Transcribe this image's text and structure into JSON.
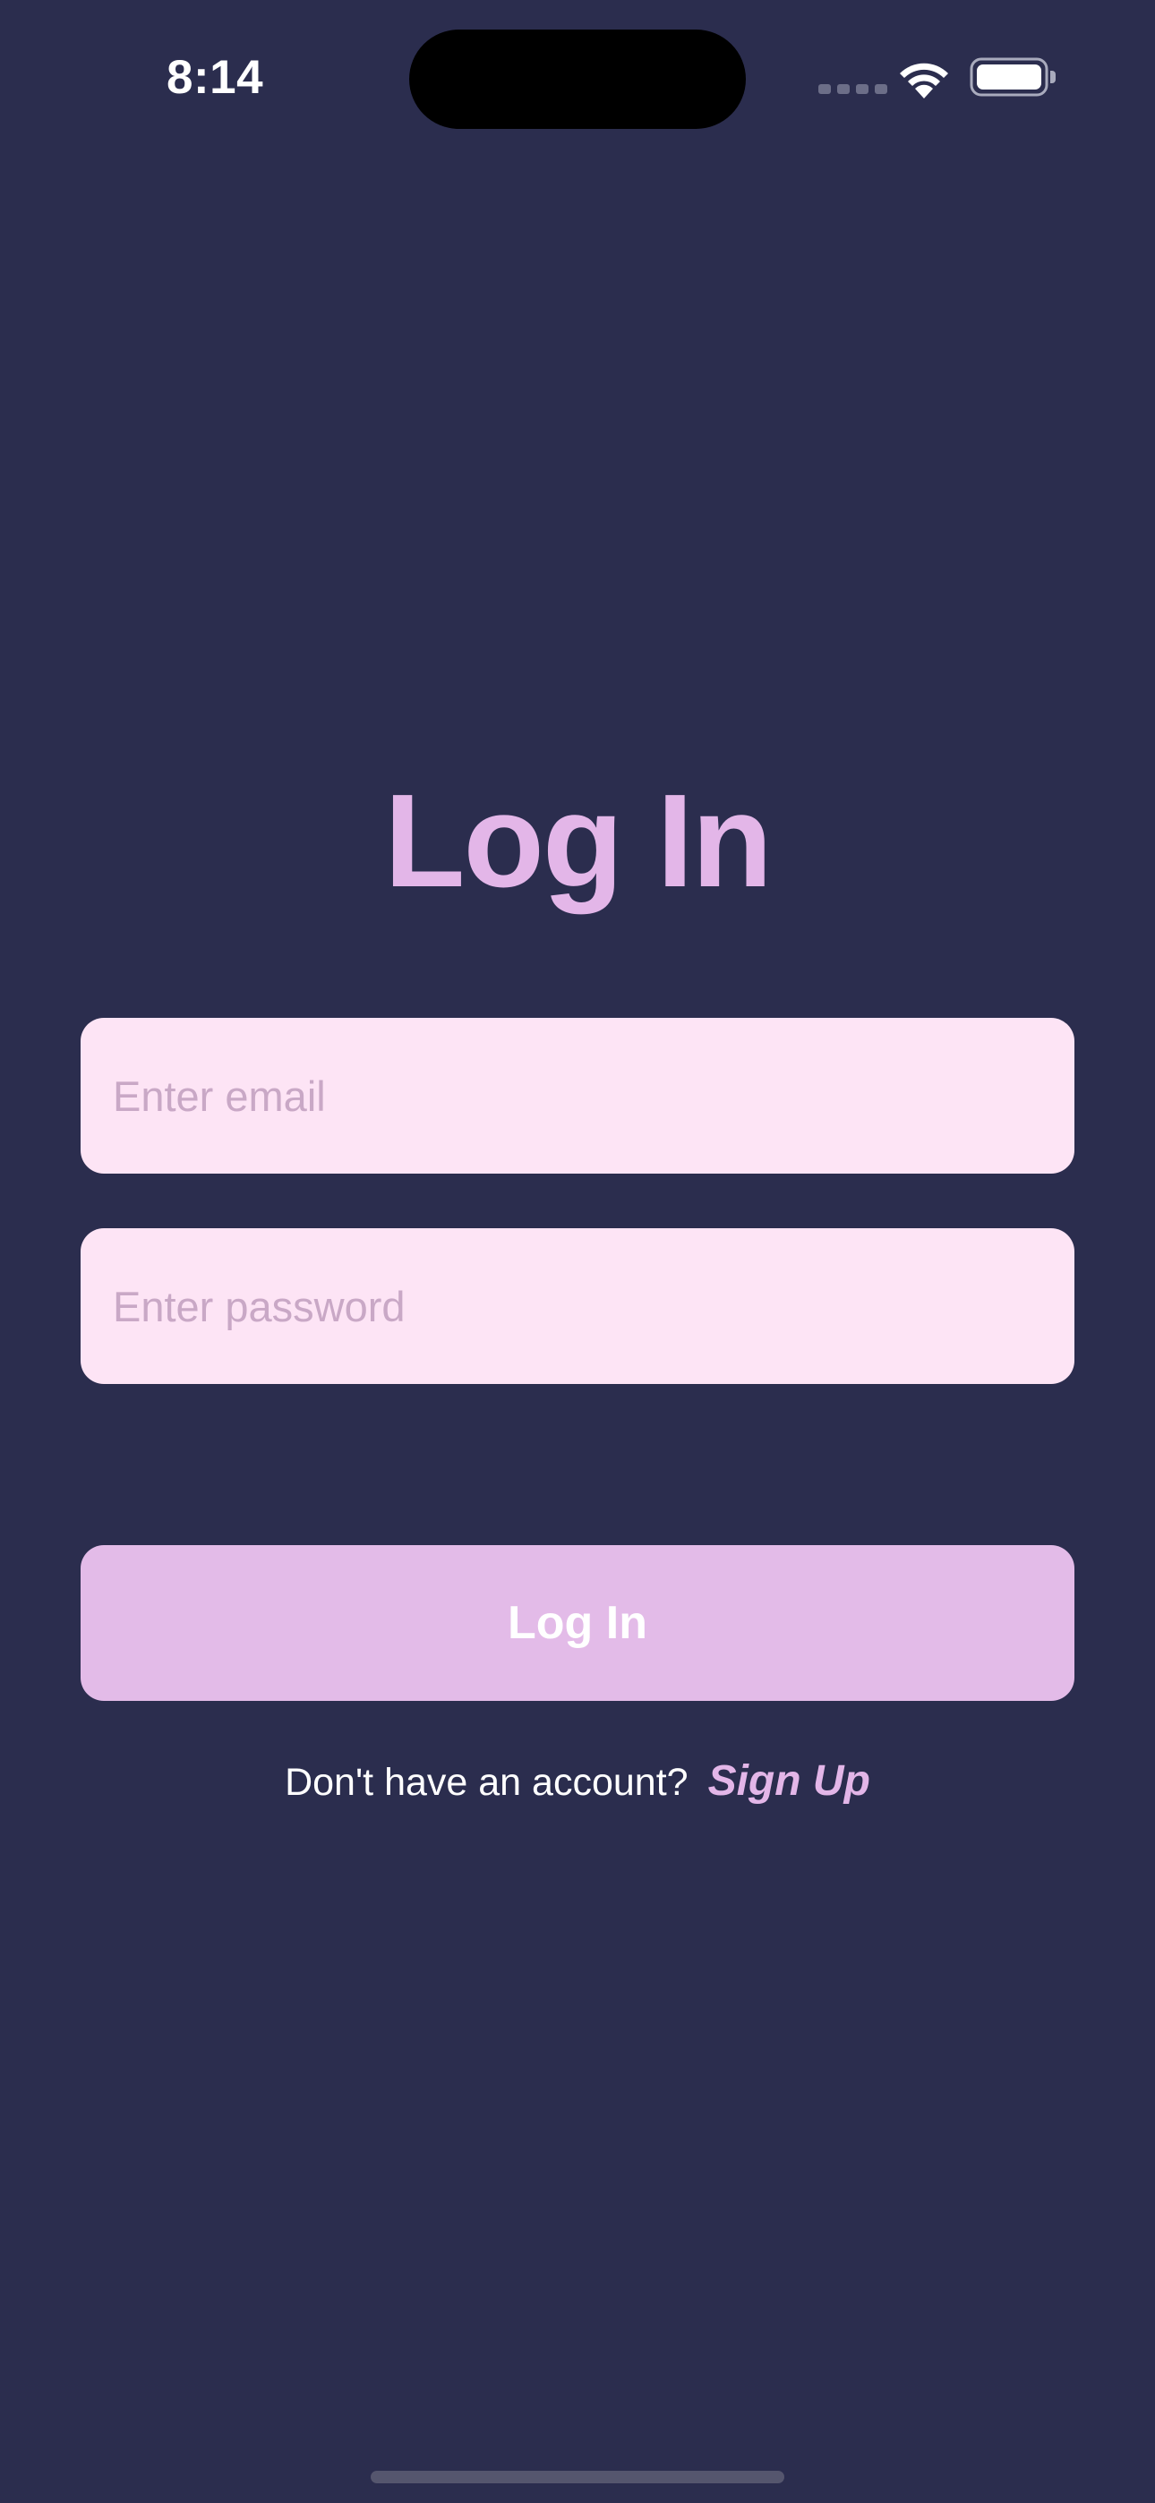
{
  "status_bar": {
    "time": "8:14"
  },
  "title": "Log In",
  "form": {
    "email_placeholder": "Enter email",
    "email_value": "",
    "password_placeholder": "Enter password",
    "password_value": ""
  },
  "login_button_label": "Log In",
  "signup": {
    "prompt": "Don't have an account?",
    "link_label": "Sign Up"
  },
  "icons": {
    "wifi": "wifi-icon",
    "battery": "battery-icon",
    "signal": "signal-dots-icon"
  },
  "colors": {
    "background": "#2b2d4e",
    "accent": "#e3b6e8",
    "field_background": "#fde4f5",
    "button_background": "#e3bbe8"
  }
}
